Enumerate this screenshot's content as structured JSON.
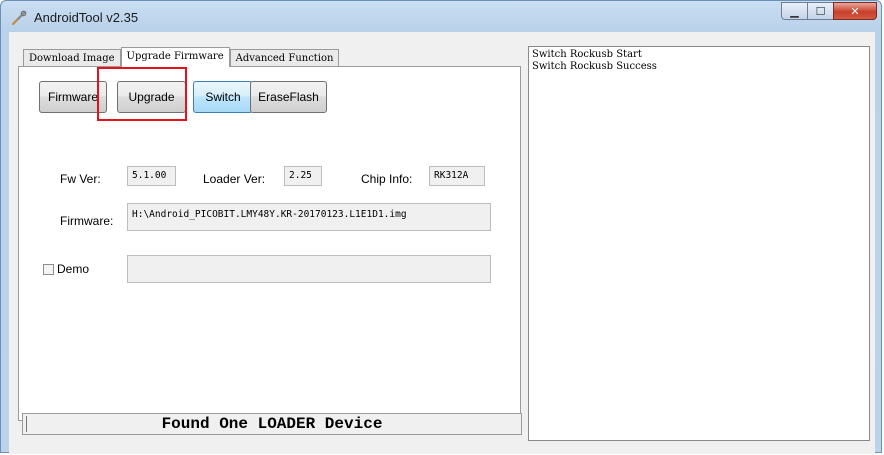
{
  "window": {
    "title": "AndroidTool v2.35",
    "accent_color": "#e8111b"
  },
  "tabs": [
    {
      "label": "Download Image",
      "active": false
    },
    {
      "label": "Upgrade Firmware",
      "active": true
    },
    {
      "label": "Advanced Function",
      "active": false
    }
  ],
  "toolbar": {
    "firmware_label": "Firmware",
    "upgrade_label": "Upgrade",
    "switch_label": "Switch",
    "eraseflash_label": "EraseFlash"
  },
  "info": {
    "fw_ver_label": "Fw Ver:",
    "fw_ver_value": "5.1.00",
    "loader_ver_label": "Loader Ver:",
    "loader_ver_value": "2.25",
    "chip_info_label": "Chip Info:",
    "chip_info_value": "RK312A",
    "firmware_label": "Firmware:",
    "firmware_path": "H:\\Android_PICOBIT.LMY48Y.KR-20170123.L1E1D1.img"
  },
  "demo": {
    "label": "Demo",
    "checked": false,
    "value": ""
  },
  "status": {
    "text": "Found One LOADER Device"
  },
  "log": {
    "lines": [
      "Switch Rockusb Start",
      "Switch Rockusb Success"
    ]
  }
}
